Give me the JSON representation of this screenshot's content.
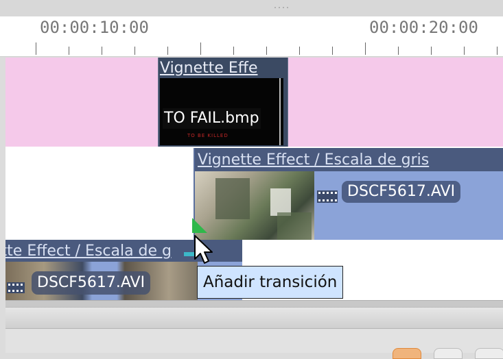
{
  "ruler": {
    "labels": [
      "00:00:10:00",
      "00:00:20:00"
    ]
  },
  "tracks": {
    "track1": {
      "clip_title": "Vignette Effe",
      "clip_filename": "TO FAIL.bmp",
      "thumb_caption": "TO BE KILLED"
    },
    "track2": {
      "clip_title": "Vignette Effect / Escala de gris",
      "clip_filename": "DSCF5617.AVI"
    },
    "track3": {
      "clip_title": "ette Effect / Escala de g",
      "clip_filename": "DSCF5617.AVI"
    }
  },
  "tooltip": {
    "text": "Añadir transición"
  },
  "colors": {
    "track1_background": "#f5c9ea",
    "clip_body": "#8ba3d8",
    "clip_titlebar": "#4a5a7e",
    "tooltip_background": "#cfe4ff",
    "transition_handle": "#2fb84a"
  },
  "icons": [
    "film-strip-icon",
    "mouse-pointer-icon",
    "grip-icon"
  ]
}
